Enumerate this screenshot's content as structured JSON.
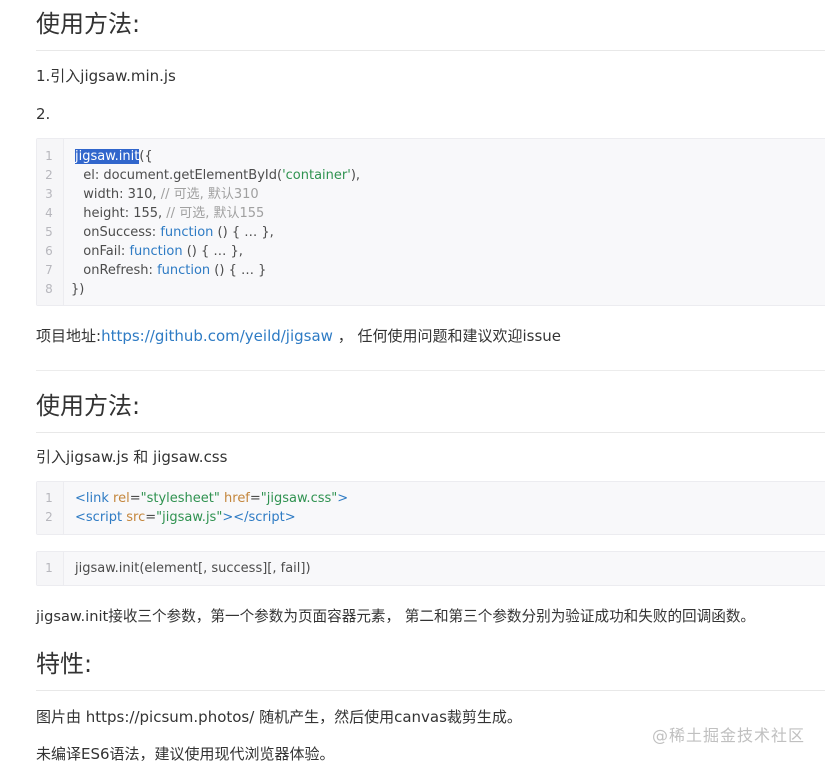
{
  "section1": {
    "heading": "使用方法:",
    "step1": "1.引入jigsaw.min.js",
    "step2": "2.",
    "code": {
      "line_numbers": [
        "1",
        "2",
        "3",
        "4",
        "5",
        "6",
        "7",
        "8"
      ],
      "l1_fn": "jigsaw.init",
      "l1_rest": "({",
      "l2_a": "  el: document.getElementById(",
      "l2_str": "'container'",
      "l2_b": "),",
      "l3_a": "  width: 310, ",
      "l3_cm": "// 可选, 默认310",
      "l4_a": "  height: 155, ",
      "l4_cm": "// 可选, 默认155",
      "l5_a": "  onSuccess: ",
      "l5_kw": "function",
      "l5_b": " () { … },",
      "l6_a": "  onFail: ",
      "l6_kw": "function",
      "l6_b": " () { … },",
      "l7_a": "  onRefresh: ",
      "l7_kw": "function",
      "l7_b": " () { … }",
      "l8": "})"
    },
    "project_label": "项目地址:",
    "project_link": "https://github.com/yeild/jigsaw",
    "project_suffix": " ， 任何使用问题和建议欢迎issue"
  },
  "section2": {
    "heading": "使用方法:",
    "intro": "引入jigsaw.js 和 jigsaw.css",
    "code1": {
      "line_numbers": [
        "1",
        "2"
      ],
      "l1_open": "<",
      "l1_tag": "link",
      "l1_attr1": "rel",
      "l1_eq1": "=",
      "l1_val1": "\"stylesheet\"",
      "l1_attr2": "href",
      "l1_eq2": "=",
      "l1_val2": "\"jigsaw.css\"",
      "l1_close": ">",
      "l2_open": "<",
      "l2_tag": "script",
      "l2_attr": "src",
      "l2_eq": "=",
      "l2_val": "\"jigsaw.js\"",
      "l2_mid": "></",
      "l2_tag2": "script",
      "l2_close": ">"
    },
    "code2": {
      "line_numbers": [
        "1"
      ],
      "l1": "jigsaw.init(element[, success][, fail])"
    },
    "description": "jigsaw.init接收三个参数，第一个参数为页面容器元素， 第二和第三个参数分别为验证成功和失败的回调函数。"
  },
  "section3": {
    "heading": "特性:",
    "item1": "图片由 https://picsum.photos/ 随机产生，然后使用canvas裁剪生成。",
    "item2": "未编译ES6语法，建议使用现代浏览器体验。"
  },
  "watermark": "@稀土掘金技术社区"
}
